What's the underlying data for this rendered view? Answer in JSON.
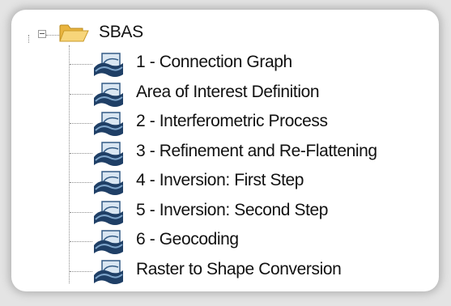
{
  "tree": {
    "root": {
      "label": "SBAS",
      "icon": "folder-open-icon",
      "expander": "collapse-minus-icon"
    },
    "items": [
      {
        "label": "1 - Connection Graph",
        "icon": "sarscape-step-icon"
      },
      {
        "label": "Area of Interest Definition",
        "icon": "sarscape-step-icon"
      },
      {
        "label": "2 - Interferometric Process",
        "icon": "sarscape-step-icon"
      },
      {
        "label": "3 - Refinement and Re-Flattening",
        "icon": "sarscape-step-icon"
      },
      {
        "label": "4 - Inversion: First Step",
        "icon": "sarscape-step-icon"
      },
      {
        "label": "5 - Inversion: Second Step",
        "icon": "sarscape-step-icon"
      },
      {
        "label": "6 - Geocoding",
        "icon": "sarscape-step-icon"
      },
      {
        "label": "Raster to Shape Conversion",
        "icon": "sarscape-step-icon"
      }
    ]
  },
  "colors": {
    "background": "#e4e4e4",
    "panel": "#ffffff",
    "icon_dark": "#1f3f66",
    "icon_light": "#d9e6f2",
    "folder": "#f2c75c"
  }
}
